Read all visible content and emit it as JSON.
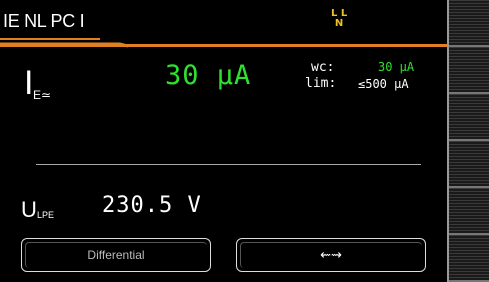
{
  "header": {
    "title": "IE NL PC I",
    "phase_top": "L L",
    "phase_bottom": "N"
  },
  "measurement": {
    "symbol": "I",
    "subscript": "E≃",
    "value": "30 μA",
    "wc_label": "wc:",
    "wc_value": "30 μA",
    "lim_label": "lim:",
    "lim_value": "≤500 μA"
  },
  "voltage": {
    "symbol": "U",
    "subscript": "LPE",
    "value": "230.5 V"
  },
  "softkeys": {
    "left_label": "Differential",
    "right_label": "⇜⇝"
  },
  "colors": {
    "accent_orange": "#e08020",
    "value_green": "#30e030",
    "phase_yellow": "#f0c020"
  }
}
